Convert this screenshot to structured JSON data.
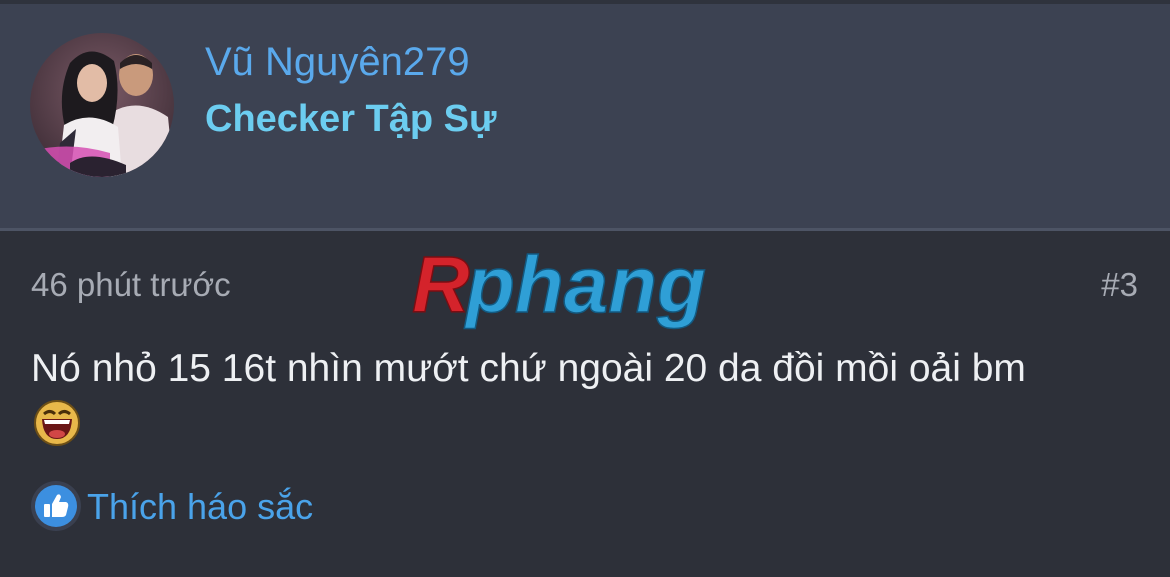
{
  "user": {
    "name": "Vũ Nguyên279",
    "title": "Checker Tập Sự",
    "avatar_icon": "avatar-photo"
  },
  "post": {
    "timestamp": "46 phút trước",
    "number": "#3",
    "message": "Nó nhỏ 15 16t nhìn mướt chứ ngoài 20 da đồi mồi oải bm",
    "emoji_icon": "laughing-emoji-icon"
  },
  "watermark": {
    "text": "Rphang",
    "colors": {
      "r": "#d4232b",
      "phang": "#2f9fd6"
    }
  },
  "reaction": {
    "label": "Thích háo sắc",
    "icon": "thumbs-up-icon"
  },
  "colors": {
    "header_bg": "#3c4252",
    "body_bg": "#2d3039",
    "username": "#5aa9ec",
    "user_title": "#6ccdf0",
    "link": "#4aa3ea"
  }
}
